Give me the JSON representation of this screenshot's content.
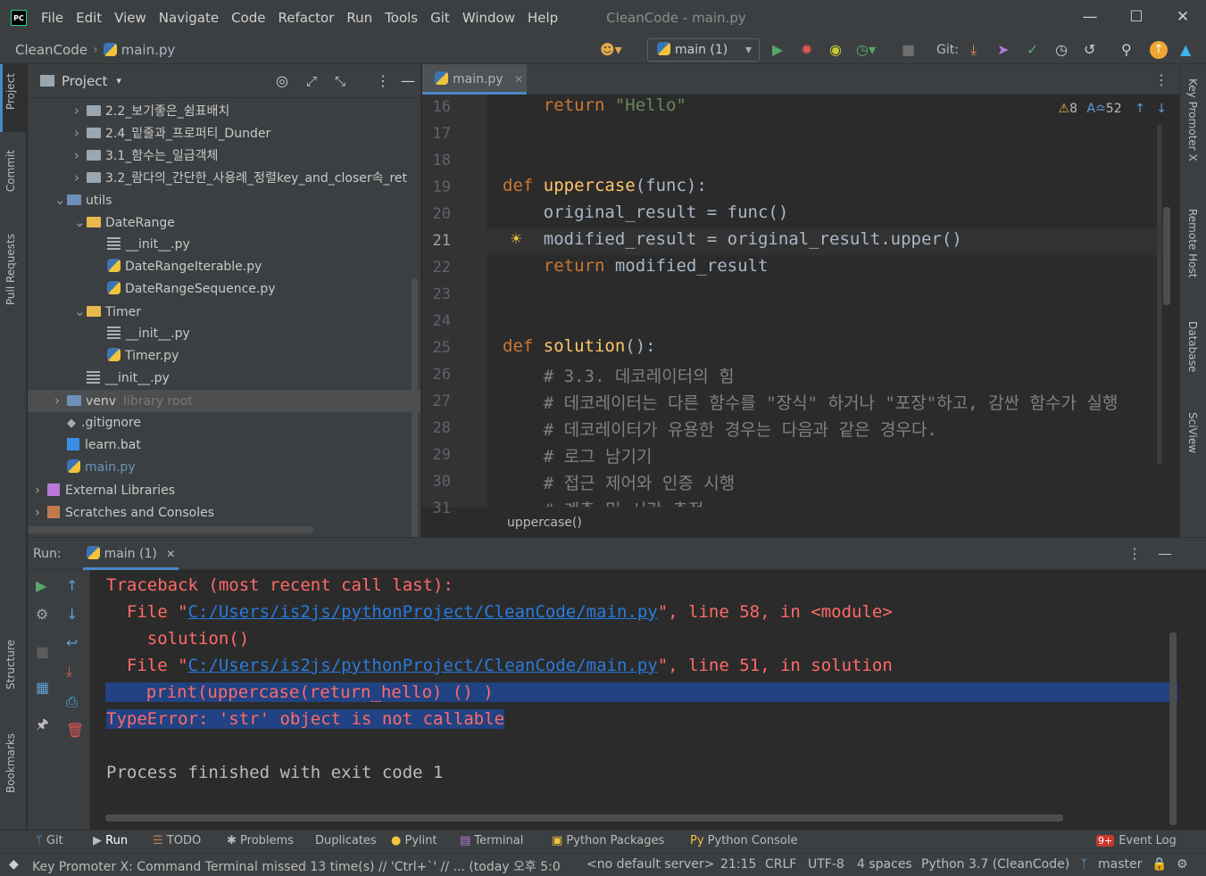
{
  "menu": [
    "File",
    "Edit",
    "View",
    "Navigate",
    "Code",
    "Refactor",
    "Run",
    "Tools",
    "Git",
    "Window",
    "Help"
  ],
  "window_title": "CleanCode - main.py",
  "breadcrumb": {
    "project": "CleanCode",
    "file": "main.py"
  },
  "run_config": "main (1)",
  "git_label": "Git:",
  "left_tabs": {
    "project": "Project",
    "commit": "Commit",
    "pull_requests": "Pull Requests",
    "structure": "Structure",
    "bookmarks": "Bookmarks"
  },
  "right_tabs": {
    "key_promoter": "Key Promoter X",
    "remote_host": "Remote Host",
    "database": "Database",
    "sciview": "SciView"
  },
  "project_panel": {
    "title": "Project",
    "tree": [
      {
        "label": "2.2_보기좋은_쉼표배치",
        "type": "folder",
        "indent": 0,
        "expanded": false
      },
      {
        "label": "2.4_밑줄과_프로퍼티_Dunder",
        "type": "folder",
        "indent": 0,
        "expanded": false
      },
      {
        "label": "3.1_함수는_일급객체",
        "type": "folder",
        "indent": 0,
        "expanded": false
      },
      {
        "label": "3.2_람다의_간단한_사용례_정렬key_and_closer속_ret",
        "type": "folder",
        "indent": 0,
        "expanded": false
      },
      {
        "label": "utils",
        "type": "pkg",
        "indent": -1,
        "expanded": true
      },
      {
        "label": "DateRange",
        "type": "pkgfolder",
        "indent": 0,
        "expanded": true
      },
      {
        "label": "__init__.py",
        "type": "init",
        "indent": 1
      },
      {
        "label": "DateRangeIterable.py",
        "type": "py",
        "indent": 1
      },
      {
        "label": "DateRangeSequence.py",
        "type": "py",
        "indent": 1
      },
      {
        "label": "Timer",
        "type": "pkgfolder",
        "indent": 0,
        "expanded": true
      },
      {
        "label": "__init__.py",
        "type": "init",
        "indent": 1
      },
      {
        "label": "Timer.py",
        "type": "py",
        "indent": 1
      },
      {
        "label": "__init__.py",
        "type": "init",
        "indent": 0
      },
      {
        "label": "venv",
        "type": "venv",
        "indent": -1,
        "expanded": false,
        "suffix": "library root"
      },
      {
        "label": ".gitignore",
        "type": "git",
        "indent": -1
      },
      {
        "label": "learn.bat",
        "type": "bat",
        "indent": -1
      },
      {
        "label": "main.py",
        "type": "pymain",
        "indent": -1
      },
      {
        "label": "External Libraries",
        "type": "lib",
        "indent": -2,
        "expanded": false
      },
      {
        "label": "Scratches and Consoles",
        "type": "scratch",
        "indent": -2,
        "expanded": false
      }
    ]
  },
  "editor": {
    "tab": "main.py",
    "warnings": "8",
    "typos": "52",
    "lines": [
      {
        "n": "16",
        "code": "    return \"Hello\""
      },
      {
        "n": "17",
        "code": ""
      },
      {
        "n": "18",
        "code": ""
      },
      {
        "n": "19",
        "code": "def uppercase(func):"
      },
      {
        "n": "20",
        "code": "    original_result = func()"
      },
      {
        "n": "21",
        "code": "    modified_result = original_result.upper()"
      },
      {
        "n": "22",
        "code": "    return modified_result"
      },
      {
        "n": "23",
        "code": ""
      },
      {
        "n": "24",
        "code": ""
      },
      {
        "n": "25",
        "code": "def solution():"
      },
      {
        "n": "26",
        "code": "    # 3.3. 데코레이터의 힘"
      },
      {
        "n": "27",
        "code": "    # 데코레이터는 다른 함수를 \"장식\" 하거나 \"포장\"하고, 감싼 함수가 실행"
      },
      {
        "n": "28",
        "code": "    # 데코레이터가 유용한 경우는 다음과 같은 경우다."
      },
      {
        "n": "29",
        "code": "    # 로그 남기기"
      },
      {
        "n": "30",
        "code": "    # 접근 제어와 인증 시행"
      },
      {
        "n": "31",
        "code": "    # 계측 및 시간 측정"
      }
    ],
    "context": "uppercase()"
  },
  "run": {
    "label": "Run:",
    "tab": "main (1)",
    "output": [
      "Traceback (most recent call last):",
      "  File \"C:/Users/is2js/pythonProject/CleanCode/main.py\", line 58, in <module>",
      "    solution()",
      "  File \"C:/Users/is2js/pythonProject/CleanCode/main.py\", line 51, in solution",
      "    print(uppercase(return_hello) () )",
      "TypeError: 'str' object is not callable",
      "",
      "Process finished with exit code 1"
    ],
    "link_path": "C:/Users/is2js/pythonProject/CleanCode/main.py"
  },
  "bottom_tools": [
    "Git",
    "Run",
    "TODO",
    "Problems",
    "Duplicates",
    "Pylint",
    "Terminal",
    "Python Packages",
    "Python Console"
  ],
  "event_log": {
    "label": "Event Log",
    "count": "9+"
  },
  "status": {
    "message": "Key Promoter X: Command Terminal missed 13 time(s) // 'Ctrl+`' // ... (today 오후 5:0",
    "server": "<no default server>",
    "position": "21:15",
    "line_sep": "CRLF",
    "encoding": "UTF-8",
    "indent": "4 spaces",
    "interpreter": "Python 3.7 (CleanCode)",
    "branch": "master"
  },
  "colors": {
    "accent": "#4a88c7",
    "error": "#ff6b68",
    "link": "#287bde",
    "selection": "#214283"
  }
}
